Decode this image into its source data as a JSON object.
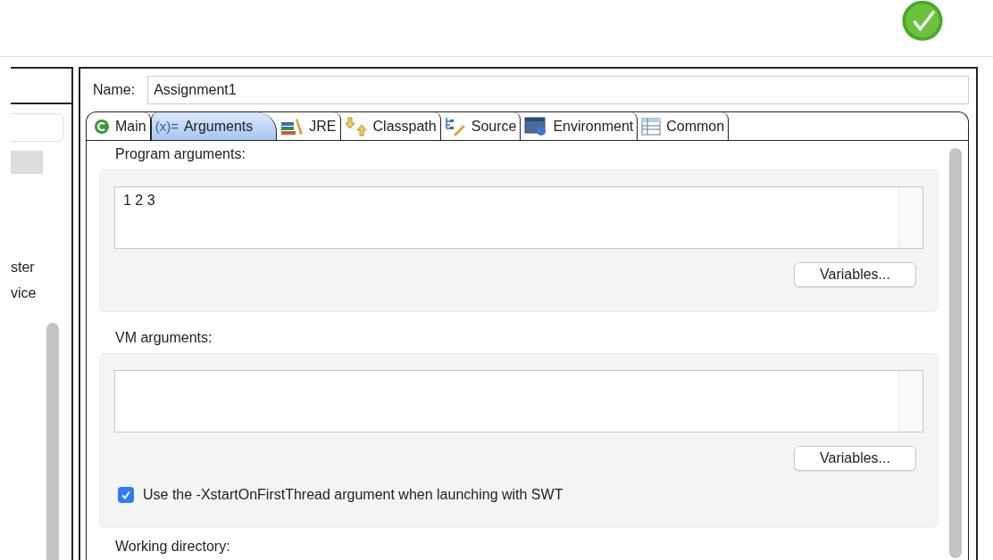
{
  "sidebar": {
    "items": [
      {
        "label": "ster"
      },
      {
        "label": "vice"
      }
    ]
  },
  "name": {
    "label": "Name:",
    "value": "Assignment1"
  },
  "tabs": [
    {
      "label": "Main",
      "kind": "main",
      "selected": false
    },
    {
      "label": "Arguments",
      "kind": "text",
      "icon_text": "(x)=",
      "selected": true
    },
    {
      "label": "JRE",
      "kind": "jre",
      "selected": false
    },
    {
      "label": "Classpath",
      "kind": "classpath",
      "selected": false
    },
    {
      "label": "Source",
      "kind": "source",
      "selected": false
    },
    {
      "label": "Environment",
      "kind": "environment",
      "selected": false
    },
    {
      "label": "Common",
      "kind": "common",
      "selected": false
    }
  ],
  "program_arguments": {
    "label": "Program arguments:",
    "value": "1 2 3",
    "button": "Variables..."
  },
  "vm_arguments": {
    "label": "VM arguments:",
    "button": "Variables...",
    "checkbox": {
      "label": "Use the -XstartOnFirstThread argument when launching with SWT",
      "checked": true
    }
  },
  "working_directory": {
    "label": "Working directory:"
  }
}
